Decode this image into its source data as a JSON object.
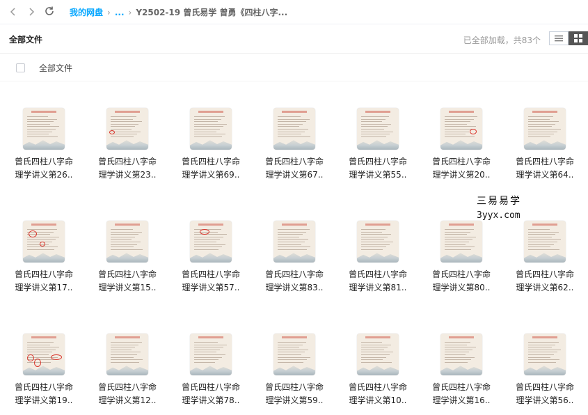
{
  "nav": {
    "back_icon": "chevron-left-icon",
    "forward_icon": "chevron-right-icon",
    "refresh_icon": "refresh-icon",
    "breadcrumb": {
      "root": "我的网盘",
      "ellipsis": "...",
      "current": "Y2502-19 曾氏易学 曾勇《四柱八字..."
    }
  },
  "header": {
    "title": "全部文件",
    "count_text": "已全部加载，共83个",
    "view_list_icon": "list-view-icon",
    "view_grid_icon": "grid-view-icon"
  },
  "select_all": {
    "label": "全部文件"
  },
  "files": [
    {
      "line1": "曾氏四柱八字命",
      "line2": "理学讲义第26.."
    },
    {
      "line1": "曾氏四柱八字命",
      "line2": "理学讲义第23.."
    },
    {
      "line1": "曾氏四柱八字命",
      "line2": "理学讲义第69.."
    },
    {
      "line1": "曾氏四柱八字命",
      "line2": "理学讲义第67.."
    },
    {
      "line1": "曾氏四柱八字命",
      "line2": "理学讲义第55.."
    },
    {
      "line1": "曾氏四柱八字命",
      "line2": "理学讲义第20.."
    },
    {
      "line1": "曾氏四柱八字命",
      "line2": "理学讲义第64.."
    },
    {
      "line1": "曾氏四柱八字命",
      "line2": "理学讲义第17.."
    },
    {
      "line1": "曾氏四柱八字命",
      "line2": "理学讲义第15.."
    },
    {
      "line1": "曾氏四柱八字命",
      "line2": "理学讲义第57.."
    },
    {
      "line1": "曾氏四柱八字命",
      "line2": "理学讲义第83.."
    },
    {
      "line1": "曾氏四柱八字命",
      "line2": "理学讲义第81.."
    },
    {
      "line1": "曾氏四柱八字命",
      "line2": "理学讲义第80.."
    },
    {
      "line1": "曾氏四柱八字命",
      "line2": "理学讲义第62.."
    },
    {
      "line1": "曾氏四柱八字命",
      "line2": "理学讲义第19.."
    },
    {
      "line1": "曾氏四柱八字命",
      "line2": "理学讲义第12.."
    },
    {
      "line1": "曾氏四柱八字命",
      "line2": "理学讲义第78.."
    },
    {
      "line1": "曾氏四柱八字命",
      "line2": "理学讲义第59.."
    },
    {
      "line1": "曾氏四柱八字命",
      "line2": "理学讲义第10.."
    },
    {
      "line1": "曾氏四柱八字命",
      "line2": "理学讲义第16.."
    },
    {
      "line1": "曾氏四柱八字命",
      "line2": "理学讲义第56.."
    }
  ],
  "watermark": {
    "line1": "三易易学",
    "line2": "3yyx.com"
  }
}
